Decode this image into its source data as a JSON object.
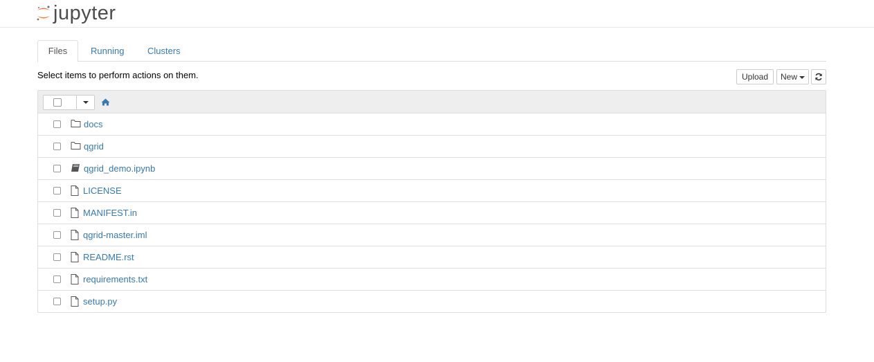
{
  "app": {
    "logo_text": "jupyter"
  },
  "tabs": [
    {
      "label": "Files",
      "active": true
    },
    {
      "label": "Running",
      "active": false
    },
    {
      "label": "Clusters",
      "active": false
    }
  ],
  "toolbar": {
    "instructions": "Select items to perform actions on them.",
    "upload_label": "Upload",
    "new_label": "New"
  },
  "files": [
    {
      "name": "docs",
      "type": "folder"
    },
    {
      "name": "qgrid",
      "type": "folder"
    },
    {
      "name": "qgrid_demo.ipynb",
      "type": "notebook"
    },
    {
      "name": "LICENSE",
      "type": "file"
    },
    {
      "name": "MANIFEST.in",
      "type": "file"
    },
    {
      "name": "qgrid-master.iml",
      "type": "file"
    },
    {
      "name": "README.rst",
      "type": "file"
    },
    {
      "name": "requirements.txt",
      "type": "file"
    },
    {
      "name": "setup.py",
      "type": "file"
    }
  ],
  "colors": {
    "link": "#337ab7",
    "logo_orange": "#f37726",
    "header_bg": "#eeeeee"
  }
}
